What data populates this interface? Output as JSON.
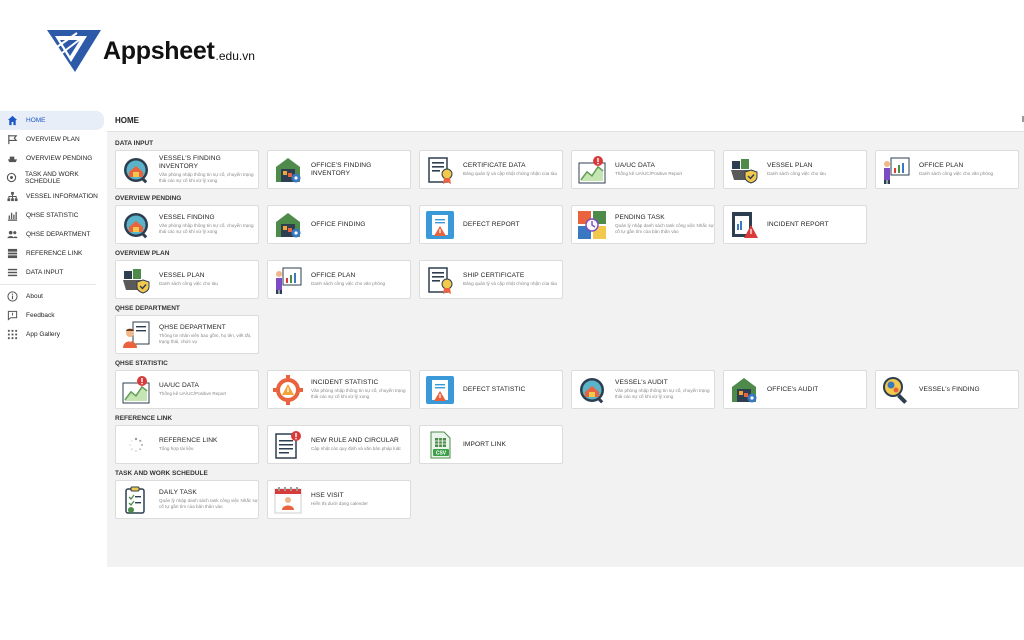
{
  "logo": {
    "name": "Appsheet",
    "suffix": ".edu.vn"
  },
  "sidebar": {
    "items": [
      {
        "label": "HOME",
        "icon": "home-icon",
        "active": true
      },
      {
        "label": "OVERVIEW PLAN",
        "icon": "flag-icon"
      },
      {
        "label": "OVERVIEW PENDING",
        "icon": "ship-icon"
      },
      {
        "label": "TASK AND WORK SCHEDULE",
        "icon": "target-icon"
      },
      {
        "label": "VESSEL INFORMATION",
        "icon": "hierarchy-icon"
      },
      {
        "label": "QHSE STATISTIC",
        "icon": "chart-icon"
      },
      {
        "label": "QHSE DEPARTMENT",
        "icon": "people-icon"
      },
      {
        "label": "REFERENCE LINK",
        "icon": "dashboard-icon"
      },
      {
        "label": "DATA INPUT",
        "icon": "list-icon"
      }
    ],
    "extra": [
      {
        "label": "About",
        "icon": "info-icon"
      },
      {
        "label": "Feedback",
        "icon": "feedback-icon"
      },
      {
        "label": "App Gallery",
        "icon": "grid-icon"
      }
    ]
  },
  "header": {
    "title": "HOME"
  },
  "sections": [
    {
      "title": "DATA INPUT",
      "cards": [
        {
          "title": "VESSEL'S FINDING INVENTORY",
          "subtitle": "Văn phòng nhập thông tin sự cố, chuyển trạng thái các sự cố khi xử lý xong",
          "icon": "warehouse-magnifier-icon"
        },
        {
          "title": "OFFICE'S FINDING INVENTORY",
          "subtitle": "",
          "icon": "warehouse-gear-icon"
        },
        {
          "title": "CERTIFICATE DATA",
          "subtitle": "Bảng quản lý và cập nhật chứng nhận của tàu",
          "icon": "certificate-icon"
        },
        {
          "title": "UA/UC DATA",
          "subtitle": "Thống kê UA/UC/Positive Report",
          "icon": "alert-chart-icon"
        },
        {
          "title": "VESSEL PLAN",
          "subtitle": "Danh sách công việc cho tàu",
          "icon": "cargo-shield-icon"
        },
        {
          "title": "OFFICE PLAN",
          "subtitle": "Danh sách công việc cho văn phòng",
          "icon": "presenter-board-icon"
        }
      ]
    },
    {
      "title": "OVERVIEW PENDING",
      "cards": [
        {
          "title": "VESSEL FINDING",
          "subtitle": "Văn phòng nhập thông tin sự cố, chuyển trạng thái các sự cố khi xử lý xong",
          "icon": "warehouse-magnifier-icon"
        },
        {
          "title": "OFFICE FINDING",
          "subtitle": "",
          "icon": "warehouse-gear-icon"
        },
        {
          "title": "DEFECT REPORT",
          "subtitle": "",
          "icon": "defect-report-icon"
        },
        {
          "title": "PENDING TASK",
          "subtitle": "Quản lý nhập danh sách task công việc Nhắc sự cố tự gần tìm của bản thân vào",
          "icon": "pending-task-icon"
        },
        {
          "title": "INCIDENT REPORT",
          "subtitle": "",
          "icon": "incident-report-icon"
        }
      ]
    },
    {
      "title": "OVERVIEW PLAN",
      "cards": [
        {
          "title": "VESSEL PLAN",
          "subtitle": "Danh sách công việc cho tàu",
          "icon": "cargo-shield-icon"
        },
        {
          "title": "OFFICE PLAN",
          "subtitle": "Danh sách công việc cho văn phòng",
          "icon": "presenter-board-icon"
        },
        {
          "title": "SHIP CERTIFICATE",
          "subtitle": "Bảng quản lý và cập nhật chứng nhận của tàu",
          "icon": "certificate-icon"
        }
      ]
    },
    {
      "title": "QHSE DEPARTMENT",
      "cards": [
        {
          "title": "QHSE DEPARTMENT",
          "subtitle": "Thông tin nhân viên bao gồm, họ tên, viết tắt, trạng thái, chức vụ",
          "icon": "employee-document-icon"
        }
      ]
    },
    {
      "title": "QHSE STATISTIC",
      "cards": [
        {
          "title": "UA/UC DATA",
          "subtitle": "Thống kê UA/UC/Positive Report",
          "icon": "alert-chart-icon"
        },
        {
          "title": "INCIDENT STATISTIC",
          "subtitle": "Văn phòng nhập thông tin sự cố, chuyển trạng thái các sự cố khi xử lý xong",
          "icon": "gear-warning-icon"
        },
        {
          "title": "DEFECT STATISTIC",
          "subtitle": "",
          "icon": "defect-report-icon"
        },
        {
          "title": "VESSEL's AUDIT",
          "subtitle": "Văn phòng nhập thông tin sự cố, chuyển trạng thái các sự cố khi xử lý xong",
          "icon": "warehouse-magnifier-icon"
        },
        {
          "title": "OFFICE's AUDIT",
          "subtitle": "",
          "icon": "warehouse-gear-icon"
        },
        {
          "title": "VESSEL's FINDING",
          "subtitle": "",
          "icon": "magnifier-gears-icon"
        }
      ]
    },
    {
      "title": "REFERENCE LINK",
      "cards": [
        {
          "title": "REFERENCE LINK",
          "subtitle": "Tổng hợp tài liệu",
          "icon": "loading-spinner-icon"
        },
        {
          "title": "NEW RULE AND CIRCULAR",
          "subtitle": "Cập nhật các quy định và văn bản pháp luật",
          "icon": "document-alert-icon"
        },
        {
          "title": "IMPORT LINK",
          "subtitle": "",
          "icon": "csv-file-icon"
        }
      ]
    },
    {
      "title": "TASK AND WORK SCHEDULE",
      "cards": [
        {
          "title": "DAILY TASK",
          "subtitle": "Quản lý nhập danh sách task công việc Nhắc sự cố tự gần tìm của bản thân vào",
          "icon": "clipboard-check-icon"
        },
        {
          "title": "HSE VISIT",
          "subtitle": "Hiển thị dưới dạng calender",
          "icon": "calendar-person-icon"
        }
      ]
    }
  ]
}
